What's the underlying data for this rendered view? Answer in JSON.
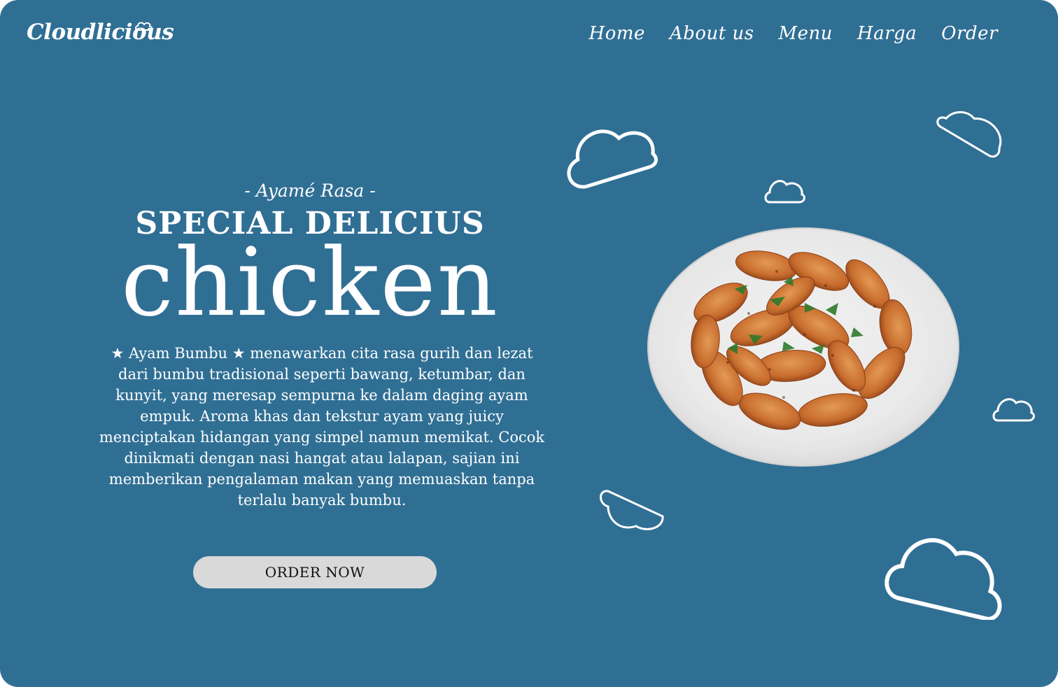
{
  "brand": {
    "name": "Cloudlicious"
  },
  "nav": {
    "items": [
      "Home",
      "About us",
      "Menu",
      "Harga",
      "Order"
    ]
  },
  "hero": {
    "tagline": "- Ayamé Rasa -",
    "headline": "SPECIAL DELICIUS",
    "big_word": "chicken",
    "description": "★ Ayam Bumbu ★ menawarkan cita rasa gurih dan lezat dari bumbu tradisional seperti bawang, ketumbar, dan kunyit, yang meresap sempurna ke dalam daging ayam empuk. Aroma khas dan tekstur ayam yang juicy menciptakan hidangan yang simpel namun memikat. Cocok dinikmati dengan nasi hangat atau lalapan, sajian ini memberikan pengalaman makan yang memuaskan tanpa terlalu banyak bumbu.",
    "cta_label": "ORDER NOW"
  },
  "theme": {
    "background": "#306f94",
    "text": "#ffffff",
    "button_bg": "#d9d9d9",
    "button_text": "#111111"
  },
  "icons": {
    "clouds": "cloud-outline-icon",
    "dish": "chicken-plate-image"
  }
}
